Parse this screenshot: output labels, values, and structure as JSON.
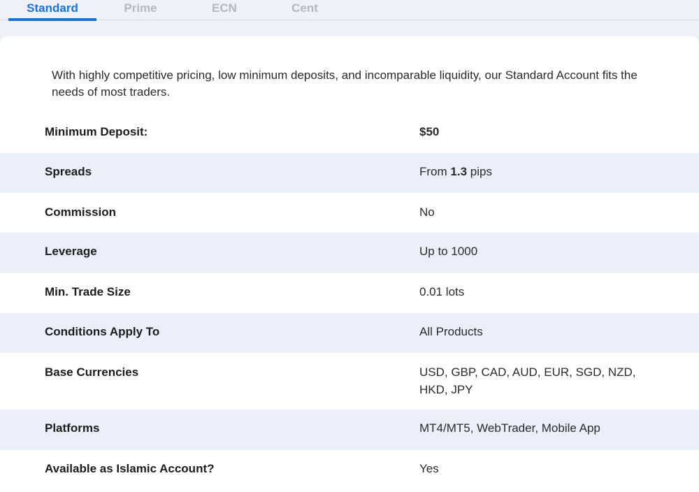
{
  "tabs": [
    {
      "label": "Standard",
      "active": true
    },
    {
      "label": "Prime",
      "active": false
    },
    {
      "label": "ECN",
      "active": false
    },
    {
      "label": "Cent",
      "active": false
    }
  ],
  "intro": "With highly competitive pricing, low minimum deposits, and incomparable liquidity, our Standard Account fits the needs of most traders.",
  "rows": [
    {
      "label": "Minimum Deposit:",
      "value": "$50"
    },
    {
      "label": "Spreads",
      "value_prefix": "From ",
      "value_bold": "1.3",
      "value_suffix": " pips"
    },
    {
      "label": "Commission",
      "value": "No"
    },
    {
      "label": "Leverage",
      "value": "Up to 1000"
    },
    {
      "label": "Min. Trade Size",
      "value": "0.01 lots"
    },
    {
      "label": "Conditions Apply To",
      "value": "All Products"
    },
    {
      "label": "Base Currencies",
      "value": "USD, GBP, CAD, AUD, EUR, SGD, NZD, HKD, JPY"
    },
    {
      "label": "Platforms",
      "value": "MT4/MT5, WebTrader, Mobile App"
    },
    {
      "label": "Available as Islamic Account?",
      "value": "Yes"
    }
  ],
  "colors": {
    "accent": "#1a73d9",
    "row_alt": "#eaeff9",
    "page_bg": "#eef1f8"
  }
}
